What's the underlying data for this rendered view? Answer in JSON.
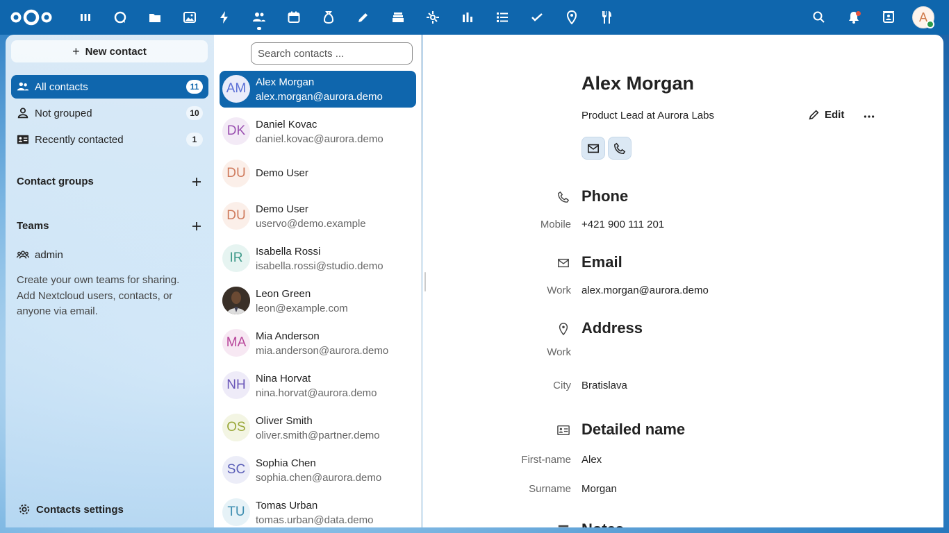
{
  "topbar": {
    "apps": [
      "dashboard-icon",
      "talk-icon",
      "files-icon",
      "photos-icon",
      "activity-icon",
      "contacts-icon",
      "calendar-icon",
      "deck-money-icon",
      "notes-icon",
      "layers-icon",
      "circle-icon",
      "analytics-icon",
      "tasks-icon",
      "checkmark-icon",
      "maps-icon",
      "cookbook-icon"
    ],
    "avatar_letter": "A"
  },
  "nav": {
    "new_contact": "New contact",
    "items": [
      {
        "label": "All contacts",
        "count": "11"
      },
      {
        "label": "Not grouped",
        "count": "10"
      },
      {
        "label": "Recently contacted",
        "count": "1"
      }
    ],
    "contact_groups": "Contact groups",
    "teams": "Teams",
    "team_admin": "admin",
    "teams_help": "Create your own teams for sharing. Add Nextcloud users, contacts, or anyone via email.",
    "settings": "Contacts settings"
  },
  "list": {
    "search_placeholder": "Search contacts ...",
    "contacts": [
      {
        "initials": "AM",
        "name": "Alex Morgan",
        "email": "alex.morgan@aurora.demo",
        "color": "#5a6fd6",
        "bg": "#e9ecfa"
      },
      {
        "initials": "DK",
        "name": "Daniel Kovac",
        "email": "daniel.kovac@aurora.demo",
        "color": "#9a4fb0",
        "bg": "#f3eaf6"
      },
      {
        "initials": "DU",
        "name": "Demo User",
        "email": "",
        "color": "#cf7b5d",
        "bg": "#fbefe9"
      },
      {
        "initials": "DU",
        "name": "Demo User",
        "email": "uservo@demo.example",
        "color": "#cf7b5d",
        "bg": "#fbefe9"
      },
      {
        "initials": "IR",
        "name": "Isabella Rossi",
        "email": "isabella.rossi@studio.demo",
        "color": "#3e9a8a",
        "bg": "#e6f4f1"
      },
      {
        "initials": "",
        "name": "Leon Green",
        "email": "leon@example.com",
        "color": "#fff",
        "bg": "#3a3028"
      },
      {
        "initials": "MA",
        "name": "Mia Anderson",
        "email": "mia.anderson@aurora.demo",
        "color": "#b8459a",
        "bg": "#f7e8f3"
      },
      {
        "initials": "NH",
        "name": "Nina Horvat",
        "email": "nina.horvat@aurora.demo",
        "color": "#6a56b8",
        "bg": "#eeebf8"
      },
      {
        "initials": "OS",
        "name": "Oliver Smith",
        "email": "oliver.smith@partner.demo",
        "color": "#9aa83a",
        "bg": "#f3f5e3"
      },
      {
        "initials": "SC",
        "name": "Sophia Chen",
        "email": "sophia.chen@aurora.demo",
        "color": "#5b5fb8",
        "bg": "#ecedf8"
      },
      {
        "initials": "TU",
        "name": "Tomas Urban",
        "email": "tomas.urban@data.demo",
        "color": "#3e8eb0",
        "bg": "#e6f2f7"
      }
    ]
  },
  "detail": {
    "name": "Alex Morgan",
    "title": "Product Lead at Aurora Labs",
    "edit": "Edit",
    "phone": {
      "heading": "Phone",
      "label": "Mobile",
      "value": "+421 900 111 201"
    },
    "email": {
      "heading": "Email",
      "label": "Work",
      "value": "alex.morgan@aurora.demo"
    },
    "address": {
      "heading": "Address",
      "label": "Work",
      "city_label": "City",
      "city": "Bratislava"
    },
    "detailed": {
      "heading": "Detailed name",
      "first_label": "First-name",
      "first": "Alex",
      "surname_label": "Surname",
      "surname": "Morgan"
    },
    "next_heading": "Notes"
  }
}
